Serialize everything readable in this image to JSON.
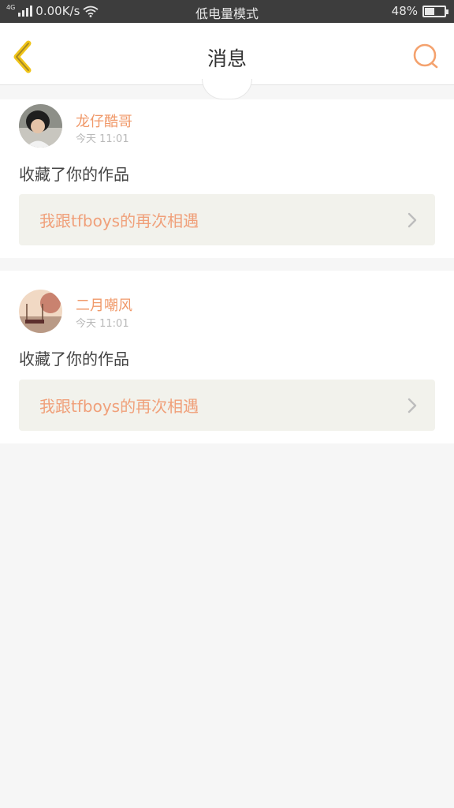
{
  "status_bar": {
    "signal_tag": "4G",
    "speed": "0.00K/s",
    "mode": "低电量模式",
    "battery": "48%",
    "battery_level": 0.48
  },
  "header": {
    "title": "消息",
    "back_icon": "chevron-left-icon",
    "search_icon": "search-icon",
    "accent_color": "#f0c419"
  },
  "notifications": [
    {
      "username": "龙仔酷哥",
      "time": "今天 11:01",
      "message": "收藏了你的作品",
      "work_title": "我跟tfboys的再次相遇"
    },
    {
      "username": "二月嘲风",
      "time": "今天 11:01",
      "message": "收藏了你的作品",
      "work_title": "我跟tfboys的再次相遇"
    }
  ],
  "colors": {
    "username": "#f0996a",
    "link_bg": "#f2f2ec",
    "search_accent": "#f4a26e"
  }
}
